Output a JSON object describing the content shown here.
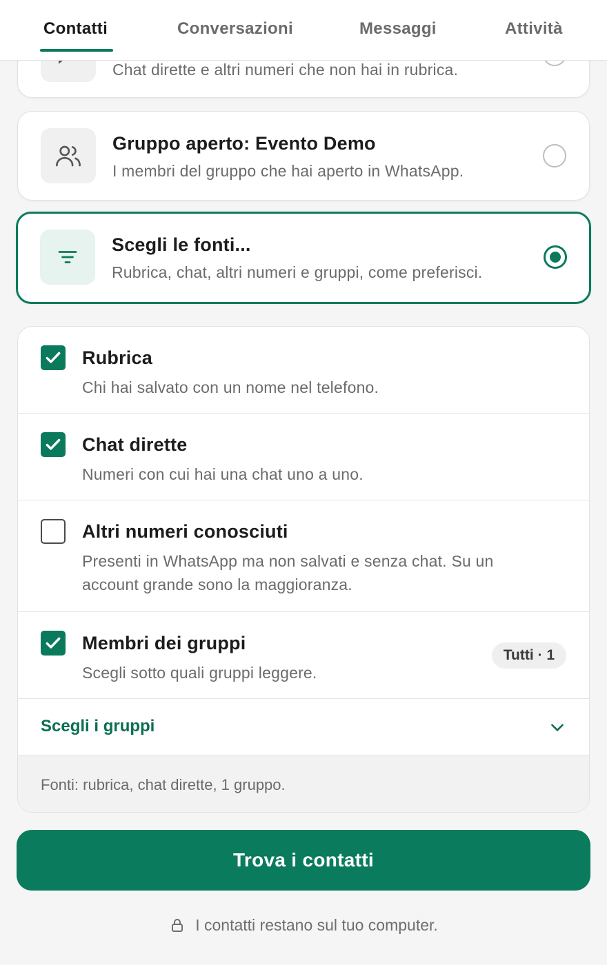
{
  "tabs": [
    {
      "label": "Contatti",
      "active": true
    },
    {
      "label": "Conversazioni",
      "active": false
    },
    {
      "label": "Messaggi",
      "active": false
    },
    {
      "label": "Attività",
      "active": false
    }
  ],
  "options": [
    {
      "desc": "Chat dirette e altri numeri che non hai in rubrica.",
      "icon": "chat-icon",
      "selected": false
    },
    {
      "title": "Gruppo aperto: Evento Demo",
      "desc": "I membri del gruppo che hai aperto in WhatsApp.",
      "icon": "users-icon",
      "selected": false
    },
    {
      "title": "Scegli le fonti...",
      "desc": "Rubrica, chat, altri numeri e gruppi, come preferisci.",
      "icon": "filter-icon",
      "selected": true
    }
  ],
  "sources": [
    {
      "title": "Rubrica",
      "desc": "Chi hai salvato con un nome nel telefono.",
      "checked": true
    },
    {
      "title": "Chat dirette",
      "desc": "Numeri con cui hai una chat uno a uno.",
      "checked": true
    },
    {
      "title": "Altri numeri conosciuti",
      "desc": "Presenti in WhatsApp ma non salvati e senza chat. Su un account grande sono la maggioranza.",
      "checked": false
    },
    {
      "title": "Membri dei gruppi",
      "desc": "Scegli sotto quali gruppi leggere.",
      "checked": true,
      "badge": "Tutti · 1"
    }
  ],
  "groups_toggle": {
    "label": "Scegli i gruppi",
    "icon": "chevron-down-icon"
  },
  "summary": "Fonti: rubrica, chat dirette, 1 gruppo.",
  "cta": {
    "label": "Trova i contatti"
  },
  "footer": {
    "note": "I contatti restano sul tuo computer.",
    "icon": "lock-icon"
  },
  "colors": {
    "accent": "#0b7a5c",
    "background": "#f5f5f5",
    "card": "#ffffff",
    "muted_text": "#6b6b6b"
  }
}
